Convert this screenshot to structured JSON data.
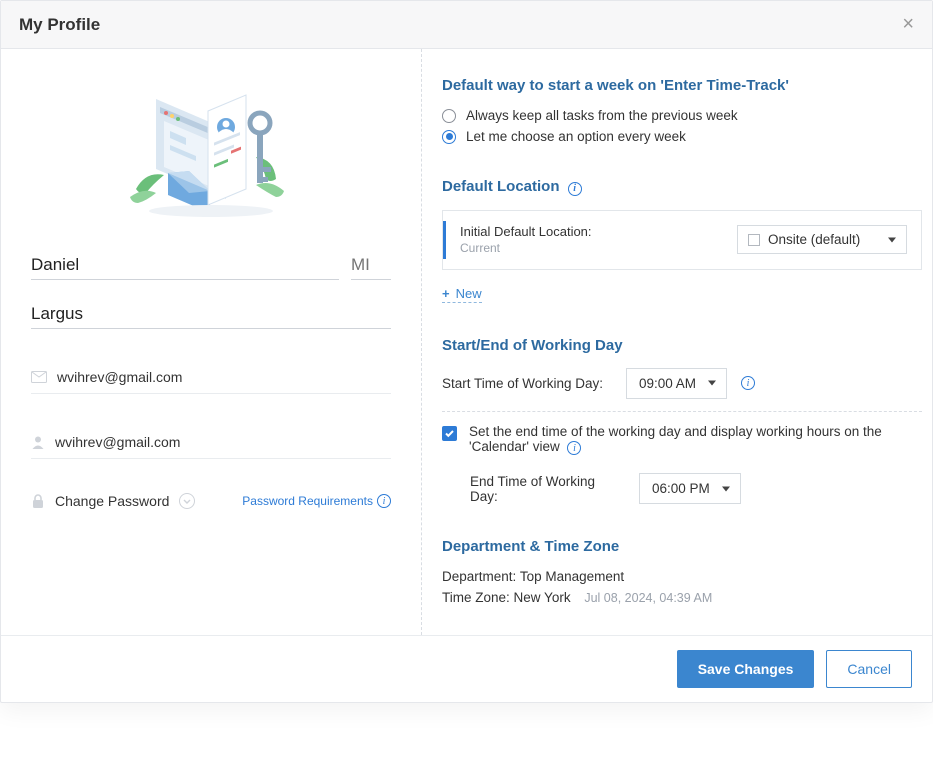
{
  "header": {
    "title": "My Profile"
  },
  "profile": {
    "first_name": "Daniel",
    "mi_placeholder": "MI",
    "last_name": "Largus",
    "email": "wvihrev@gmail.com",
    "username": "wvihrev@gmail.com",
    "change_password": "Change Password",
    "pw_req": "Password Requirements"
  },
  "start_week": {
    "title": "Default way to start a week on 'Enter Time-Track'",
    "opt_keep": "Always keep all tasks from the previous week",
    "opt_choose": "Let me choose an option every week"
  },
  "location": {
    "title": "Default Location",
    "initial_label": "Initial Default Location:",
    "current": "Current",
    "selected": "Onsite (default)",
    "new": "New"
  },
  "workday": {
    "title": "Start/End of Working Day",
    "start_label": "Start Time of Working Day:",
    "start_value": "09:00 AM",
    "set_end_label": "Set the end time of the working day and display working hours on the 'Calendar' view",
    "end_label": "End Time of Working Day:",
    "end_value": "06:00 PM"
  },
  "dept": {
    "title": "Department & Time Zone",
    "dept_label": "Department:",
    "dept_value": "Top Management",
    "tz_label": "Time Zone:",
    "tz_value": "New York",
    "timestamp": "Jul 08, 2024, 04:39 AM"
  },
  "footer": {
    "save": "Save Changes",
    "cancel": "Cancel"
  }
}
